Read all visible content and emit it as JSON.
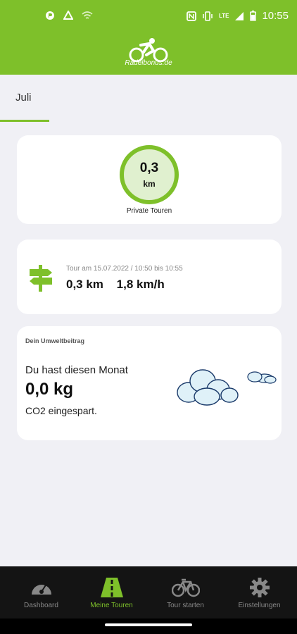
{
  "status_bar": {
    "time": "10:55",
    "network_label": "LTE",
    "left_icons": [
      "app-notification-icon",
      "recycle-notification-icon",
      "wifi-off-icon"
    ],
    "right_icons": [
      "nfc-icon",
      "vibrate-icon",
      "signal-icon",
      "battery-icon"
    ]
  },
  "header": {
    "logo_text": "Radelbonus.de",
    "brand_color": "#7ec02a"
  },
  "tabs": [
    {
      "label": "Juli",
      "active": true
    }
  ],
  "summary": {
    "distance_value": "0,3",
    "distance_unit": "km",
    "caption": "Private Touren"
  },
  "tour": {
    "icon": "signpost-icon",
    "meta": "Tour am 15.07.2022 / 10:50 bis 10:55",
    "distance": "0,3 km",
    "speed": "1,8 km/h"
  },
  "eco": {
    "title": "Dein Umweltbeitrag",
    "line1": "Du hast diesen Monat",
    "value": "0,0 kg",
    "line2": "CO2 eingespart.",
    "icon": "clouds-icon"
  },
  "bottom_nav": {
    "items": [
      {
        "label": "Dashboard",
        "icon": "gauge-icon",
        "active": false
      },
      {
        "label": "Meine Touren",
        "icon": "road-icon",
        "active": true
      },
      {
        "label": "Tour starten",
        "icon": "bicycle-icon",
        "active": false
      },
      {
        "label": "Einstellungen",
        "icon": "gear-icon",
        "active": false
      }
    ],
    "active_color": "#7ec02a",
    "inactive_color": "#888888"
  }
}
